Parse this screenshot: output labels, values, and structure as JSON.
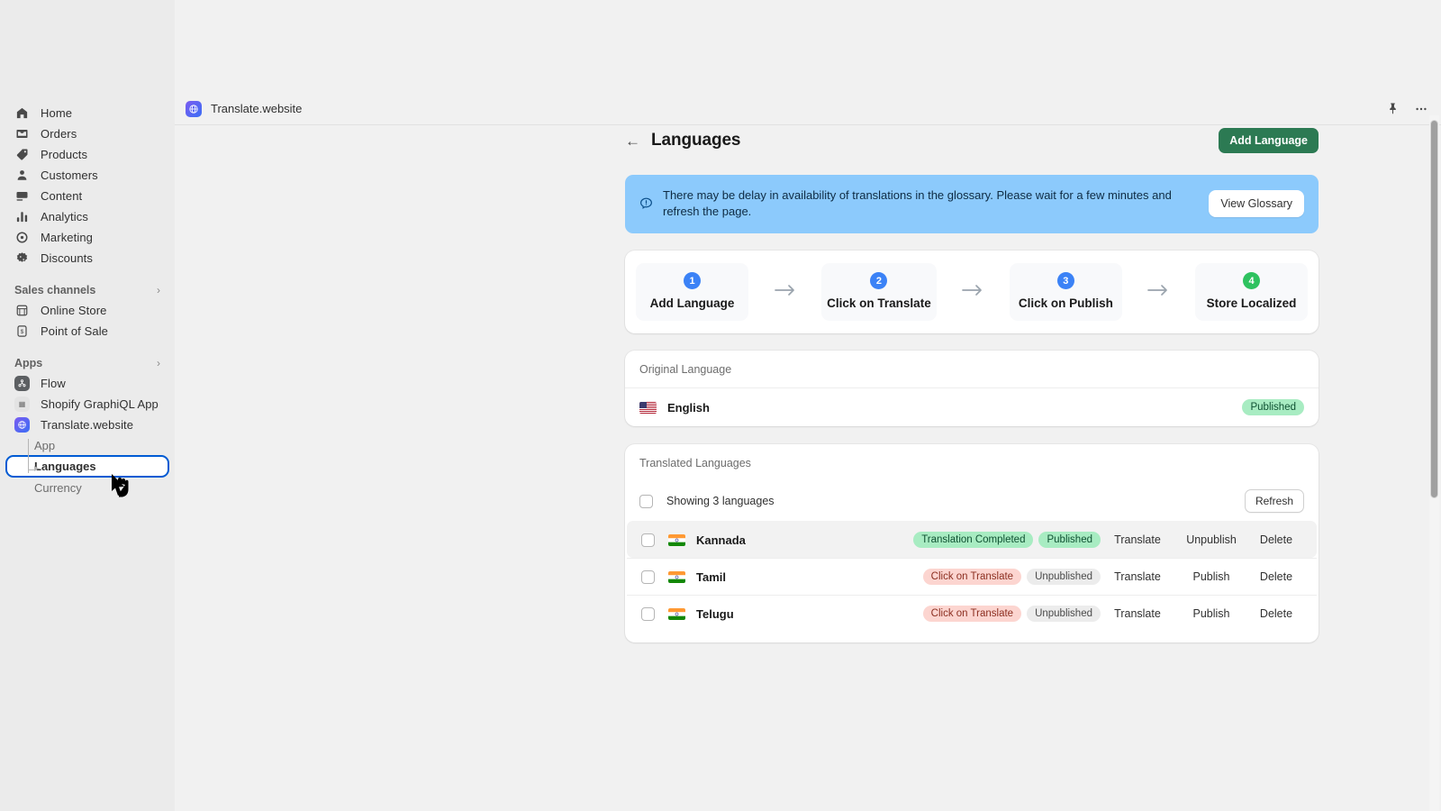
{
  "sidebar": {
    "main_items": [
      {
        "label": "Home",
        "icon": "home-icon"
      },
      {
        "label": "Orders",
        "icon": "orders-icon"
      },
      {
        "label": "Products",
        "icon": "products-tag-icon"
      },
      {
        "label": "Customers",
        "icon": "customers-person-icon"
      },
      {
        "label": "Content",
        "icon": "content-icon"
      },
      {
        "label": "Analytics",
        "icon": "analytics-bars-icon"
      },
      {
        "label": "Marketing",
        "icon": "marketing-target-icon"
      },
      {
        "label": "Discounts",
        "icon": "discounts-badge-icon"
      }
    ],
    "sales_channels": {
      "title": "Sales channels",
      "items": [
        {
          "label": "Online Store",
          "icon": "storefront-icon"
        },
        {
          "label": "Point of Sale",
          "icon": "pos-icon"
        }
      ]
    },
    "apps": {
      "title": "Apps",
      "items": [
        {
          "label": "Flow",
          "icon": "flow-app-icon"
        },
        {
          "label": "Shopify GraphiQL App",
          "icon": "graphiql-app-icon"
        },
        {
          "label": "Translate.website",
          "icon": "translate-website-app-icon"
        }
      ],
      "sub_items": [
        {
          "label": "App",
          "active": false
        },
        {
          "label": "Languages",
          "active": true
        },
        {
          "label": "Currency",
          "active": false
        }
      ]
    }
  },
  "topbar": {
    "app_name": "Translate.website",
    "pin_icon": "pin-icon",
    "more_icon": "more-horizontal-icon"
  },
  "page": {
    "back_icon": "back-arrow-icon",
    "title": "Languages",
    "add_language_button": "Add Language"
  },
  "banner": {
    "icon": "info-alert-icon",
    "message": "There may be delay in availability of translations in the glossary. Please wait for a few minutes and refresh the page.",
    "action_label": "View Glossary",
    "background_color": "#8ccafc"
  },
  "steps": {
    "arrow_icon": "arrow-right-icon",
    "items": [
      {
        "number": "1",
        "label": "Add Language",
        "color": "#3b82f6"
      },
      {
        "number": "2",
        "label": "Click on Translate",
        "color": "#3b82f6"
      },
      {
        "number": "3",
        "label": "Click on Publish",
        "color": "#3b82f6"
      },
      {
        "number": "4",
        "label": "Store Localized",
        "color": "#2ec25f"
      }
    ]
  },
  "original_language": {
    "section_label": "Original Language",
    "name": "English",
    "flag": "flag-us",
    "status": "Published"
  },
  "translated_languages": {
    "section_label": "Translated Languages",
    "count_label": "Showing 3 languages",
    "refresh_label": "Refresh",
    "rows": [
      {
        "name": "Kannada",
        "flag": "flag-in",
        "translation_status": "Translation Completed",
        "translation_status_type": "green",
        "publish_status": "Published",
        "publish_status_type": "green",
        "action_translate": "Translate",
        "action_publish": "Unpublish",
        "action_delete": "Delete",
        "hovered": true
      },
      {
        "name": "Tamil",
        "flag": "flag-in",
        "translation_status": "Click on Translate",
        "translation_status_type": "red",
        "publish_status": "Unpublished",
        "publish_status_type": "gray",
        "action_translate": "Translate",
        "action_publish": "Publish",
        "action_delete": "Delete",
        "hovered": false
      },
      {
        "name": "Telugu",
        "flag": "flag-in",
        "translation_status": "Click on Translate",
        "translation_status_type": "red",
        "publish_status": "Unpublished",
        "publish_status_type": "gray",
        "action_translate": "Translate",
        "action_publish": "Publish",
        "action_delete": "Delete",
        "hovered": false
      }
    ]
  },
  "colors": {
    "primary_green": "#2c7a53",
    "accent_blue": "#005bd3",
    "banner_blue": "#8ccafc",
    "badge_green_bg": "#a8ecc2",
    "badge_red_bg": "#fcd5d0"
  }
}
